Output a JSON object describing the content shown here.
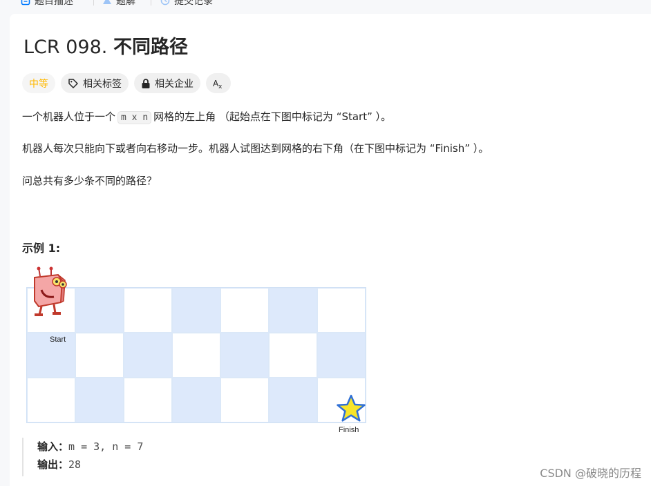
{
  "tabs": [
    {
      "label": "题目描述",
      "icon": "description-icon"
    },
    {
      "label": "题解",
      "icon": "flask-icon"
    },
    {
      "label": "提交记录",
      "icon": "history-icon"
    }
  ],
  "problem": {
    "id_prefix": "LCR 098.",
    "name": "不同路径"
  },
  "tags": {
    "difficulty": "中等",
    "related_tags": "相关标签",
    "related_companies": "相关企业",
    "translate_icon": "translate-icon"
  },
  "description": {
    "p1_before": "一个机器人位于一个",
    "p1_code": "m x n",
    "p1_after": "网格的左上角 （起始点在下图中标记为 “Start” ）。",
    "p2": "机器人每次只能向下或者向右移动一步。机器人试图达到网格的右下角（在下图中标记为 “Finish” ）。",
    "p3": "问总共有多少条不同的路径？"
  },
  "example": {
    "title": "示例 1:",
    "start_label": "Start",
    "finish_label": "Finish",
    "input_key": "输入：",
    "input_value": "m = 3, n = 7",
    "output_key": "输出：",
    "output_value": "28"
  },
  "grid": {
    "rows": 3,
    "cols": 7,
    "blue_color": "#dde9fb"
  },
  "watermark": "CSDN @破晓的历程"
}
